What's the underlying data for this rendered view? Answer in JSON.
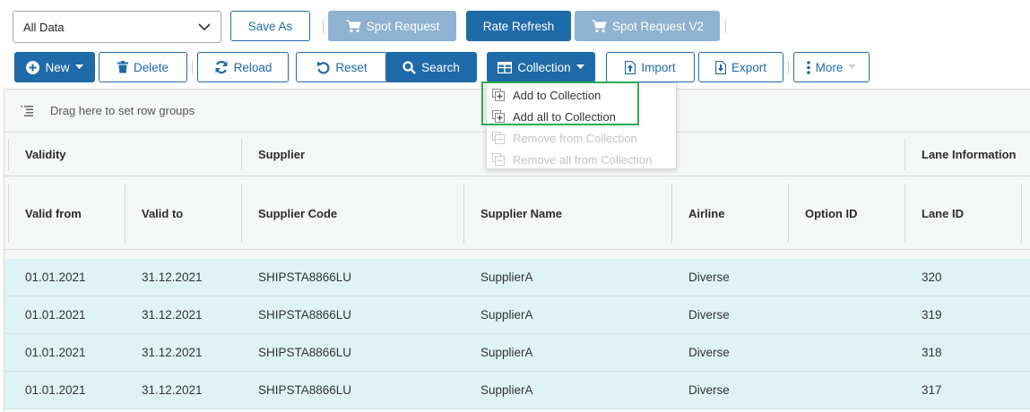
{
  "toolbar1": {
    "view_select": "All Data",
    "save_as": "Save As",
    "spot_request": "Spot Request",
    "rate_refresh": "Rate Refresh",
    "spot_request_v2": "Spot Request V2"
  },
  "toolbar2": {
    "new": "New",
    "delete": "Delete",
    "reload": "Reload",
    "reset": "Reset",
    "search": "Search",
    "collection": "Collection",
    "import": "Import",
    "export": "Export",
    "more": "More"
  },
  "collection_menu": {
    "items": [
      {
        "label": "Add to Collection",
        "enabled": true
      },
      {
        "label": "Add all to Collection",
        "enabled": true
      },
      {
        "label": "Remove from Collection",
        "enabled": false
      },
      {
        "label": "Remove all from Collection",
        "enabled": false
      }
    ]
  },
  "grid": {
    "group_bar": "Drag here to set row groups",
    "group_headers": [
      "Validity",
      "Supplier",
      "Lane Information"
    ],
    "columns": [
      "Valid from",
      "Valid to",
      "Supplier Code",
      "Supplier Name",
      "Airline",
      "Option ID",
      "Lane ID"
    ],
    "rows": [
      [
        "01.01.2021",
        "31.12.2021",
        "SHIPSTA8866LU",
        "SupplierA",
        "Diverse",
        "",
        "320"
      ],
      [
        "01.01.2021",
        "31.12.2021",
        "SHIPSTA8866LU",
        "SupplierA",
        "Diverse",
        "",
        "319"
      ],
      [
        "01.01.2021",
        "31.12.2021",
        "SHIPSTA8866LU",
        "SupplierA",
        "Diverse",
        "",
        "318"
      ],
      [
        "01.01.2021",
        "31.12.2021",
        "SHIPSTA8866LU",
        "SupplierA",
        "Diverse",
        "",
        "317"
      ]
    ]
  },
  "colors": {
    "primary": "#1f6aa8",
    "disabled": "#8fb2d0",
    "row_bg": "#dff3f7",
    "highlight": "#2bab4f"
  }
}
